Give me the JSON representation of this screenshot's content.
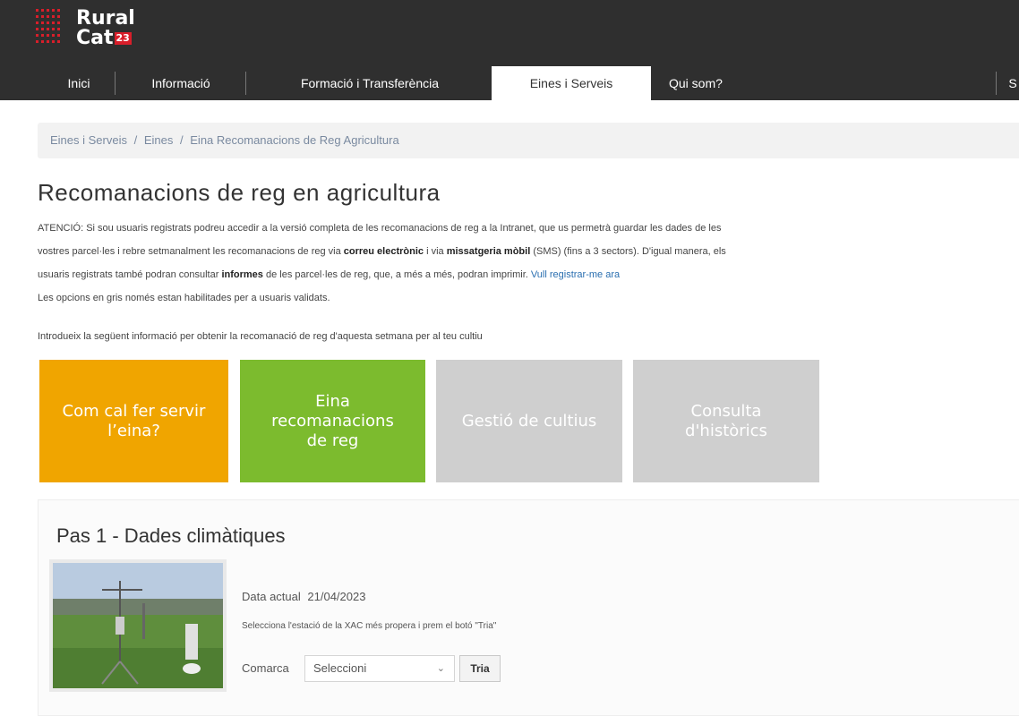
{
  "brand": {
    "line1": "Rural",
    "line2": "Cat",
    "year": "23",
    "accent": "#d81e2a"
  },
  "nav": {
    "items": [
      {
        "label": "Inici"
      },
      {
        "label": "Informació"
      },
      {
        "label": "Formació i Transferència"
      },
      {
        "label": "Eines i Serveis",
        "active": true
      },
      {
        "label": "Qui som?"
      },
      {
        "label": "S"
      }
    ]
  },
  "breadcrumb": {
    "items": [
      "Eines i Serveis",
      "Eines",
      "Eina Recomanacions de Reg Agricultura"
    ],
    "separator": "/"
  },
  "page": {
    "title": "Recomanacions de reg en agricultura",
    "notice": {
      "prefix": "ATENCIÓ: Si sou usuaris registrats podreu accedir a la versió completa de les recomanacions de reg a la Intranet, que us permetrà guardar les dades de les",
      "line2_pre": "vostres parcel·les i rebre setmanalment les recomanacions de reg via ",
      "email_bold": "correu electrònic",
      "line2_mid": " i via ",
      "sms_bold": "missatgeria mòbil",
      "line2_post": " (SMS) (fins a 3 sectors). D'igual manera, els",
      "line3_pre": "usuaris registrats també podran consultar ",
      "reports_bold": "informes",
      "line3_post": " de les parcel·les de reg, que, a més a més, podran imprimir. ",
      "register_link": "Vull registrar-me ara"
    },
    "gray_note": "Les opcions en gris només estan habilitades per a usuaris validats.",
    "intro": "Introdueix la següent informació per obtenir la recomanació de reg d'aquesta setmana per al teu cultiu"
  },
  "tiles": [
    {
      "lines": [
        "Com cal fer servir",
        "l’eina?"
      ],
      "color": "#f0a500"
    },
    {
      "lines": [
        "Eina",
        "recomanacions",
        "de reg"
      ],
      "color": "#7cbb2e"
    },
    {
      "lines": [
        "Gestió de cultius"
      ],
      "color": "#cfcfcf"
    },
    {
      "lines": [
        "Consulta",
        "d'històrics"
      ],
      "color": "#cfcfcf"
    }
  ],
  "step1": {
    "title": "Pas 1 - Dades climàtiques",
    "date_label": "Data actual",
    "date_value": "21/04/2023",
    "instruction": "Selecciona l'estació de la XAC més propera i prem el botó \"Tria\"",
    "comarca_label": "Comarca",
    "select_value": "Seleccioni",
    "button_label": "Tria"
  }
}
